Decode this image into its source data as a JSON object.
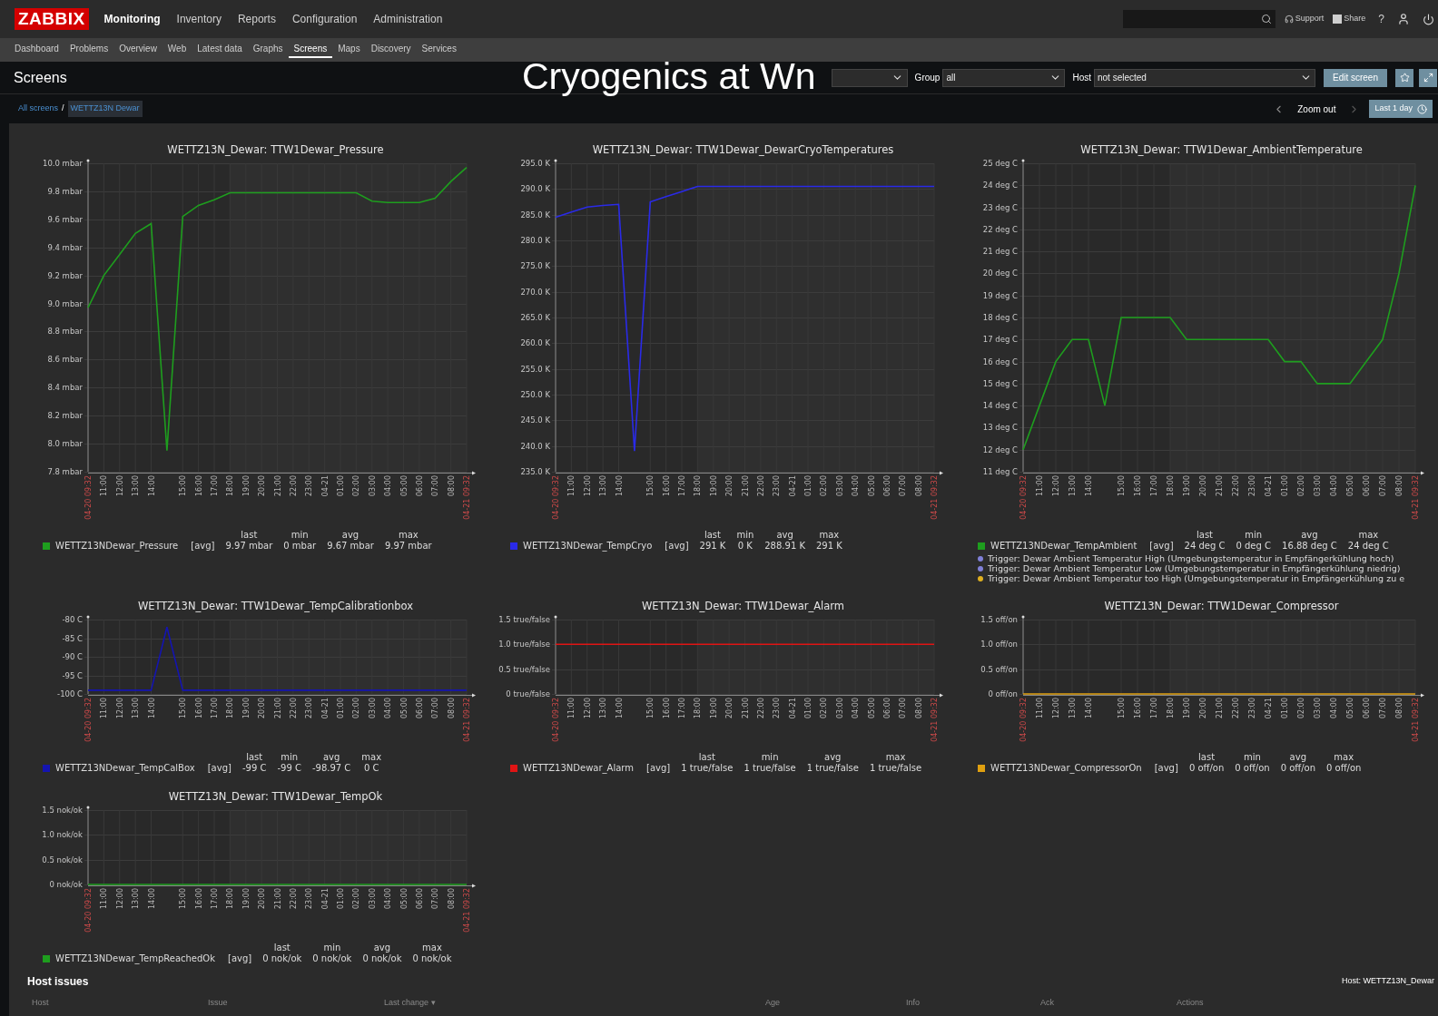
{
  "top_bar": {
    "logo": "ZABBIX",
    "main_menu": [
      {
        "label": "Monitoring",
        "selected": true
      },
      {
        "label": "Inventory",
        "selected": false
      },
      {
        "label": "Reports",
        "selected": false
      },
      {
        "label": "Configuration",
        "selected": false
      },
      {
        "label": "Administration",
        "selected": false
      }
    ],
    "links": [
      "Support",
      "Share",
      "?"
    ]
  },
  "sub_menu": [
    {
      "label": "Dashboard",
      "selected": false
    },
    {
      "label": "Problems",
      "selected": false
    },
    {
      "label": "Overview",
      "selected": false
    },
    {
      "label": "Web",
      "selected": false
    },
    {
      "label": "Latest data",
      "selected": false
    },
    {
      "label": "Graphs",
      "selected": false
    },
    {
      "label": "Screens",
      "selected": true
    },
    {
      "label": "Maps",
      "selected": false
    },
    {
      "label": "Discovery",
      "selected": false
    },
    {
      "label": "Services",
      "selected": false
    }
  ],
  "header": {
    "title": "Screens",
    "overlay_caption": "Cryogenics at Wn",
    "group_label": "Group",
    "group_value": "all",
    "host_label": "Host",
    "host_value": "not selected",
    "edit_button": "Edit screen"
  },
  "breadcrumb": {
    "items": [
      "All screens",
      "WETTZ13N Dewar"
    ],
    "separator": "/"
  },
  "time_nav": {
    "zoom_out": "Zoom out",
    "period": "Last 1 day"
  },
  "charts": [
    {
      "chart_data": {
        "type": "line",
        "grid": true,
        "title": "WETTZ13N_Dewar: TTW1Dewar_Pressure",
        "categories": [
          "04-20 09:32",
          "11:00",
          "12:00",
          "13:00",
          "14:00",
          null,
          "15:00",
          "16:00",
          "17:00",
          "18:00",
          "19:00",
          "20:00",
          "21:00",
          "22:00",
          "23:00",
          "04-21",
          "01:00",
          "02:00",
          "03:00",
          "04:00",
          "05:00",
          "06:00",
          "07:00",
          "08:00",
          "04-21 09:32"
        ],
        "series": [
          {
            "name": "WETTZ13NDewar_Pressure",
            "color": "#1e9e1e",
            "values": [
              8.97,
              9.2,
              9.35,
              9.5,
              9.57,
              7.95,
              9.62,
              9.7,
              9.74,
              9.79,
              9.79,
              9.79,
              9.79,
              9.79,
              9.79,
              9.79,
              9.79,
              9.79,
              9.73,
              9.72,
              9.72,
              9.72,
              9.75,
              9.87,
              9.97
            ]
          }
        ],
        "ylim": [
          7.8,
          10
        ],
        "yticks": [
          {
            "value": 7.8,
            "label": "7.8 mbar"
          },
          {
            "value": 8,
            "label": "8.0 mbar"
          },
          {
            "value": 8.2,
            "label": "8.2 mbar"
          },
          {
            "value": 8.4,
            "label": "8.4 mbar"
          },
          {
            "value": 8.6,
            "label": "8.6 mbar"
          },
          {
            "value": 8.8,
            "label": "8.8 mbar"
          },
          {
            "value": 9,
            "label": "9.0 mbar"
          },
          {
            "value": 9.2,
            "label": "9.2 mbar"
          },
          {
            "value": 9.4,
            "label": "9.4 mbar"
          },
          {
            "value": 9.6,
            "label": "9.6 mbar"
          },
          {
            "value": 9.8,
            "label": "9.8 mbar"
          },
          {
            "value": 10,
            "label": "10.0 mbar"
          }
        ]
      },
      "legend": {
        "function": "[avg]",
        "headers": [
          "last",
          "min",
          "avg",
          "max"
        ],
        "values": [
          "9.97 mbar",
          "0 mbar",
          "9.67 mbar",
          "9.97 mbar"
        ]
      }
    },
    {
      "chart_data": {
        "type": "line",
        "grid": true,
        "title": "WETTZ13N_Dewar: TTW1Dewar_DewarCryoTemperatures",
        "categories": [
          "04-20 09:32",
          "11:00",
          "12:00",
          "13:00",
          "14:00",
          null,
          "15:00",
          "16:00",
          "17:00",
          "18:00",
          "19:00",
          "20:00",
          "21:00",
          "22:00",
          "23:00",
          "04-21",
          "01:00",
          "02:00",
          "03:00",
          "04:00",
          "05:00",
          "06:00",
          "07:00",
          "08:00",
          "04-21 09:32"
        ],
        "series": [
          {
            "name": "WETTZ13NDewar_TempCryo",
            "color": "#2a2ae8",
            "values": [
              284.5,
              285.5,
              286.5,
              286.8,
              287,
              239,
              287.5,
              288.5,
              289.5,
              290.5,
              290.5,
              290.5,
              290.5,
              290.5,
              290.5,
              290.5,
              290.5,
              290.5,
              290.5,
              290.5,
              290.5,
              290.5,
              290.5,
              290.5,
              290.5
            ]
          }
        ],
        "ylim": [
          235,
          295
        ],
        "yticks": [
          {
            "value": 235,
            "label": "235.0 K"
          },
          {
            "value": 240,
            "label": "240.0 K"
          },
          {
            "value": 245,
            "label": "245.0 K"
          },
          {
            "value": 250,
            "label": "250.0 K"
          },
          {
            "value": 255,
            "label": "255.0 K"
          },
          {
            "value": 260,
            "label": "260.0 K"
          },
          {
            "value": 265,
            "label": "265.0 K"
          },
          {
            "value": 270,
            "label": "270.0 K"
          },
          {
            "value": 275,
            "label": "275.0 K"
          },
          {
            "value": 280,
            "label": "280.0 K"
          },
          {
            "value": 285,
            "label": "285.0 K"
          },
          {
            "value": 290,
            "label": "290.0 K"
          },
          {
            "value": 295,
            "label": "295.0 K"
          }
        ]
      },
      "legend": {
        "function": "[avg]",
        "headers": [
          "last",
          "min",
          "avg",
          "max"
        ],
        "values": [
          "291 K",
          "0 K",
          "288.91 K",
          "291 K"
        ]
      }
    },
    {
      "chart_data": {
        "type": "line",
        "grid": true,
        "title": "WETTZ13N_Dewar: TTW1Dewar_AmbientTemperature",
        "categories": [
          "04-20 09:32",
          "11:00",
          "12:00",
          "13:00",
          "14:00",
          null,
          "15:00",
          "16:00",
          "17:00",
          "18:00",
          "19:00",
          "20:00",
          "21:00",
          "22:00",
          "23:00",
          "04-21",
          "01:00",
          "02:00",
          "03:00",
          "04:00",
          "05:00",
          "06:00",
          "07:00",
          "08:00",
          "04-21 09:32"
        ],
        "series": [
          {
            "name": "WETTZ13NDewar_TempAmbient",
            "color": "#1e9e1e",
            "values": [
              12,
              14,
              16,
              17,
              17,
              14,
              18,
              18,
              18,
              18,
              17,
              17,
              17,
              17,
              17,
              17,
              16,
              16,
              15,
              15,
              15,
              16,
              17,
              20,
              24
            ]
          }
        ],
        "ylim": [
          11,
          25
        ],
        "yticks": [
          {
            "value": 11,
            "label": "11 deg C"
          },
          {
            "value": 12,
            "label": "12 deg C"
          },
          {
            "value": 13,
            "label": "13 deg C"
          },
          {
            "value": 14,
            "label": "14 deg C"
          },
          {
            "value": 15,
            "label": "15 deg C"
          },
          {
            "value": 16,
            "label": "16 deg C"
          },
          {
            "value": 17,
            "label": "17 deg C"
          },
          {
            "value": 18,
            "label": "18 deg C"
          },
          {
            "value": 19,
            "label": "19 deg C"
          },
          {
            "value": 20,
            "label": "20 deg C"
          },
          {
            "value": 21,
            "label": "21 deg C"
          },
          {
            "value": 22,
            "label": "22 deg C"
          },
          {
            "value": 23,
            "label": "23 deg C"
          },
          {
            "value": 24,
            "label": "24 deg C"
          },
          {
            "value": 25,
            "label": "25 deg C"
          }
        ]
      },
      "legend": {
        "function": "[avg]",
        "headers": [
          "last",
          "min",
          "avg",
          "max"
        ],
        "values": [
          "24 deg C",
          "0 deg C",
          "16.88 deg C",
          "24 deg C"
        ]
      },
      "triggers": [
        {
          "text": "Trigger: Dewar Ambient Temperatur High (Umgebungstemperatur in Empfängerkühlung  hoch)",
          "color": "#8080d8"
        },
        {
          "text": "Trigger: Dewar Ambient Temperatur Low (Umgebungstemperatur in Empfängerkühlung  niedrig)",
          "color": "#8080d8"
        },
        {
          "text": "Trigger: Dewar Ambient Temperatur too High (Umgebungstemperatur in Empfängerkühlung  zu e",
          "color": "#e0b020"
        }
      ]
    },
    {
      "chart_data": {
        "type": "line",
        "grid": true,
        "title": "WETTZ13N_Dewar: TTW1Dewar_TempCalibrationbox",
        "categories": [
          "04-20 09:32",
          "11:00",
          "12:00",
          "13:00",
          "14:00",
          null,
          "15:00",
          "16:00",
          "17:00",
          "18:00",
          "19:00",
          "20:00",
          "21:00",
          "22:00",
          "23:00",
          "04-21",
          "01:00",
          "02:00",
          "03:00",
          "04:00",
          "05:00",
          "06:00",
          "07:00",
          "08:00",
          "04-21 09:32"
        ],
        "series": [
          {
            "name": "WETTZ13NDewar_TempCalBox",
            "color": "#1414b0",
            "values": [
              -99,
              -99,
              -99,
              -99,
              -99,
              -82,
              -99,
              -99,
              -99,
              -99,
              -99,
              -99,
              -99,
              -99,
              -99,
              -99,
              -99,
              -99,
              -99,
              -99,
              -99,
              -99,
              -99,
              -99,
              -99
            ]
          }
        ],
        "ylim": [
          -100,
          -80
        ],
        "yticks": [
          {
            "value": -100,
            "label": "-100 C"
          },
          {
            "value": -95,
            "label": "-95 C"
          },
          {
            "value": -90,
            "label": "-90 C"
          },
          {
            "value": -85,
            "label": "-85 C"
          },
          {
            "value": -80,
            "label": "-80 C"
          }
        ]
      },
      "legend": {
        "function": "[avg]",
        "headers": [
          "last",
          "min",
          "avg",
          "max"
        ],
        "values": [
          "-99 C",
          "-99 C",
          "-98.97 C",
          "0 C"
        ]
      }
    },
    {
      "chart_data": {
        "type": "line",
        "grid": true,
        "title": "WETTZ13N_Dewar: TTW1Dewar_Alarm",
        "categories": [
          "04-20 09:32",
          "11:00",
          "12:00",
          "13:00",
          "14:00",
          null,
          "15:00",
          "16:00",
          "17:00",
          "18:00",
          "19:00",
          "20:00",
          "21:00",
          "22:00",
          "23:00",
          "04-21",
          "01:00",
          "02:00",
          "03:00",
          "04:00",
          "05:00",
          "06:00",
          "07:00",
          "08:00",
          "04-21 09:32"
        ],
        "series": [
          {
            "name": "WETTZ13NDewar_Alarm",
            "color": "#e01414",
            "values": [
              1,
              1,
              1,
              1,
              1,
              1,
              1,
              1,
              1,
              1,
              1,
              1,
              1,
              1,
              1,
              1,
              1,
              1,
              1,
              1,
              1,
              1,
              1,
              1,
              1
            ]
          }
        ],
        "ylim": [
          0,
          1.5
        ],
        "yticks": [
          {
            "value": 0,
            "label": "0 true/false"
          },
          {
            "value": 0.5,
            "label": "0.5 true/false"
          },
          {
            "value": 1,
            "label": "1.0 true/false"
          },
          {
            "value": 1.5,
            "label": "1.5 true/false"
          }
        ]
      },
      "legend": {
        "function": "[avg]",
        "headers": [
          "last",
          "min",
          "avg",
          "max"
        ],
        "values": [
          "1 true/false",
          "1 true/false",
          "1 true/false",
          "1 true/false"
        ]
      }
    },
    {
      "chart_data": {
        "type": "line",
        "grid": true,
        "title": "WETTZ13N_Dewar: TTW1Dewar_Compressor",
        "categories": [
          "04-20 09:32",
          "11:00",
          "12:00",
          "13:00",
          "14:00",
          null,
          "15:00",
          "16:00",
          "17:00",
          "18:00",
          "19:00",
          "20:00",
          "21:00",
          "22:00",
          "23:00",
          "04-21",
          "01:00",
          "02:00",
          "03:00",
          "04:00",
          "05:00",
          "06:00",
          "07:00",
          "08:00",
          "04-21 09:32"
        ],
        "series": [
          {
            "name": "WETTZ13NDewar_CompressorOn",
            "color": "#e0a010",
            "values": [
              0,
              0,
              0,
              0,
              0,
              0,
              0,
              0,
              0,
              0,
              0,
              0,
              0,
              0,
              0,
              0,
              0,
              0,
              0,
              0,
              0,
              0,
              0,
              0,
              0
            ]
          }
        ],
        "ylim": [
          0,
          1.5
        ],
        "yticks": [
          {
            "value": 0,
            "label": "0 off/on"
          },
          {
            "value": 0.5,
            "label": "0.5 off/on"
          },
          {
            "value": 1,
            "label": "1.0 off/on"
          },
          {
            "value": 1.5,
            "label": "1.5 off/on"
          }
        ]
      },
      "legend": {
        "function": "[avg]",
        "headers": [
          "last",
          "min",
          "avg",
          "max"
        ],
        "values": [
          "0 off/on",
          "0 off/on",
          "0 off/on",
          "0 off/on"
        ]
      }
    },
    {
      "chart_data": {
        "type": "line",
        "grid": true,
        "title": "WETTZ13N_Dewar: TTW1Dewar_TempOk",
        "categories": [
          "04-20 09:32",
          "11:00",
          "12:00",
          "13:00",
          "14:00",
          null,
          "15:00",
          "16:00",
          "17:00",
          "18:00",
          "19:00",
          "20:00",
          "21:00",
          "22:00",
          "23:00",
          "04-21",
          "01:00",
          "02:00",
          "03:00",
          "04:00",
          "05:00",
          "06:00",
          "07:00",
          "08:00",
          "04-21 09:32"
        ],
        "series": [
          {
            "name": "WETTZ13NDewar_TempReachedOk",
            "color": "#1e9e1e",
            "values": [
              0,
              0,
              0,
              0,
              0,
              0,
              0,
              0,
              0,
              0,
              0,
              0,
              0,
              0,
              0,
              0,
              0,
              0,
              0,
              0,
              0,
              0,
              0,
              0,
              0
            ]
          }
        ],
        "ylim": [
          0,
          1.5
        ],
        "yticks": [
          {
            "value": 0,
            "label": "0 nok/ok"
          },
          {
            "value": 0.5,
            "label": "0.5 nok/ok"
          },
          {
            "value": 1,
            "label": "1.0 nok/ok"
          },
          {
            "value": 1.5,
            "label": "1.5 nok/ok"
          }
        ]
      },
      "legend": {
        "function": "[avg]",
        "headers": [
          "last",
          "min",
          "avg",
          "max"
        ],
        "values": [
          "0 nok/ok",
          "0 nok/ok",
          "0 nok/ok",
          "0 nok/ok"
        ]
      }
    }
  ],
  "host_issues": {
    "title": "Host issues",
    "host_caption": "Host: WETTZ13N_Dewar",
    "columns": [
      "Host",
      "Issue",
      "Last change ▾",
      "Age",
      "Info",
      "Ack",
      "Actions"
    ]
  }
}
